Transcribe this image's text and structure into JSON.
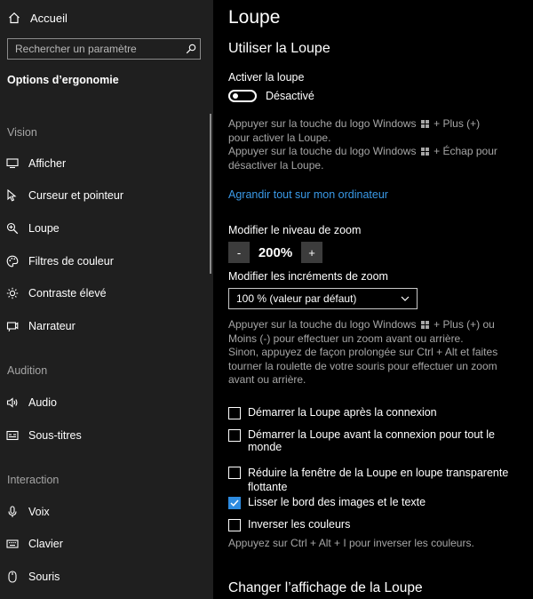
{
  "sidebar": {
    "home_label": "Accueil",
    "search_placeholder": "Rechercher un paramètre",
    "section_title": "Options d’ergonomie",
    "groups": {
      "vision": "Vision",
      "audition": "Audition",
      "interaction": "Interaction"
    },
    "items": [
      {
        "label": "Afficher",
        "icon": "display-icon"
      },
      {
        "label": "Curseur et pointeur",
        "icon": "cursor-icon"
      },
      {
        "label": "Loupe",
        "icon": "magnifier-icon"
      },
      {
        "label": "Filtres de couleur",
        "icon": "palette-icon"
      },
      {
        "label": "Contraste élevé",
        "icon": "contrast-icon"
      },
      {
        "label": "Narrateur",
        "icon": "narrator-icon"
      },
      {
        "label": "Audio",
        "icon": "speaker-icon"
      },
      {
        "label": "Sous-titres",
        "icon": "captions-icon"
      },
      {
        "label": "Voix",
        "icon": "microphone-icon"
      },
      {
        "label": "Clavier",
        "icon": "keyboard-icon"
      },
      {
        "label": "Souris",
        "icon": "mouse-icon"
      }
    ]
  },
  "main": {
    "page_title": "Loupe",
    "section_title": "Utiliser la Loupe",
    "enable_label": "Activer la loupe",
    "toggle_state": "Désactivé",
    "hint1_a": "Appuyer sur la touche du logo Windows",
    "hint1_b": "+ Plus (+) pour activer la Loupe.",
    "hint2_a": "Appuyer sur la touche du logo Windows",
    "hint2_b": "+ Échap pour désactiver la Loupe.",
    "zoom_link": "Agrandir tout sur mon ordinateur",
    "zoom_level_label": "Modifier le niveau de zoom",
    "zoom_minus": "-",
    "zoom_value": "200%",
    "zoom_plus": "+",
    "increments_label": "Modifier les incréments de zoom",
    "increments_value": "100 % (valeur par défaut)",
    "zoom_hint_a": "Appuyer sur la touche du logo Windows",
    "zoom_hint_b": "+ Plus (+) ou Moins (-) pour effectuer un zoom avant ou arrière.",
    "zoom_hint_c": "Sinon, appuyez de façon prolongée sur Ctrl + Alt et faites tourner la roulette de votre souris pour effectuer un zoom avant ou arrière.",
    "checkboxes": [
      {
        "label": "Démarrer la Loupe après la connexion",
        "checked": false
      },
      {
        "label": "Démarrer la Loupe avant la connexion pour tout le monde",
        "checked": false
      },
      {
        "label": "Réduire la fenêtre de la Loupe en loupe transparente flottante",
        "checked": false
      },
      {
        "label": "Lisser le bord des images et le texte",
        "checked": true
      },
      {
        "label": "Inverser les couleurs",
        "checked": false
      }
    ],
    "invert_hint": "Appuyez sur Ctrl + Alt + I pour inverser les couleurs.",
    "change_view_title": "Changer l’affichage de la Loupe"
  },
  "colors": {
    "accent": "#2d8be0",
    "link": "#3a9ae8",
    "sidebar_bg": "#1f1f1f",
    "main_bg": "#000000"
  }
}
